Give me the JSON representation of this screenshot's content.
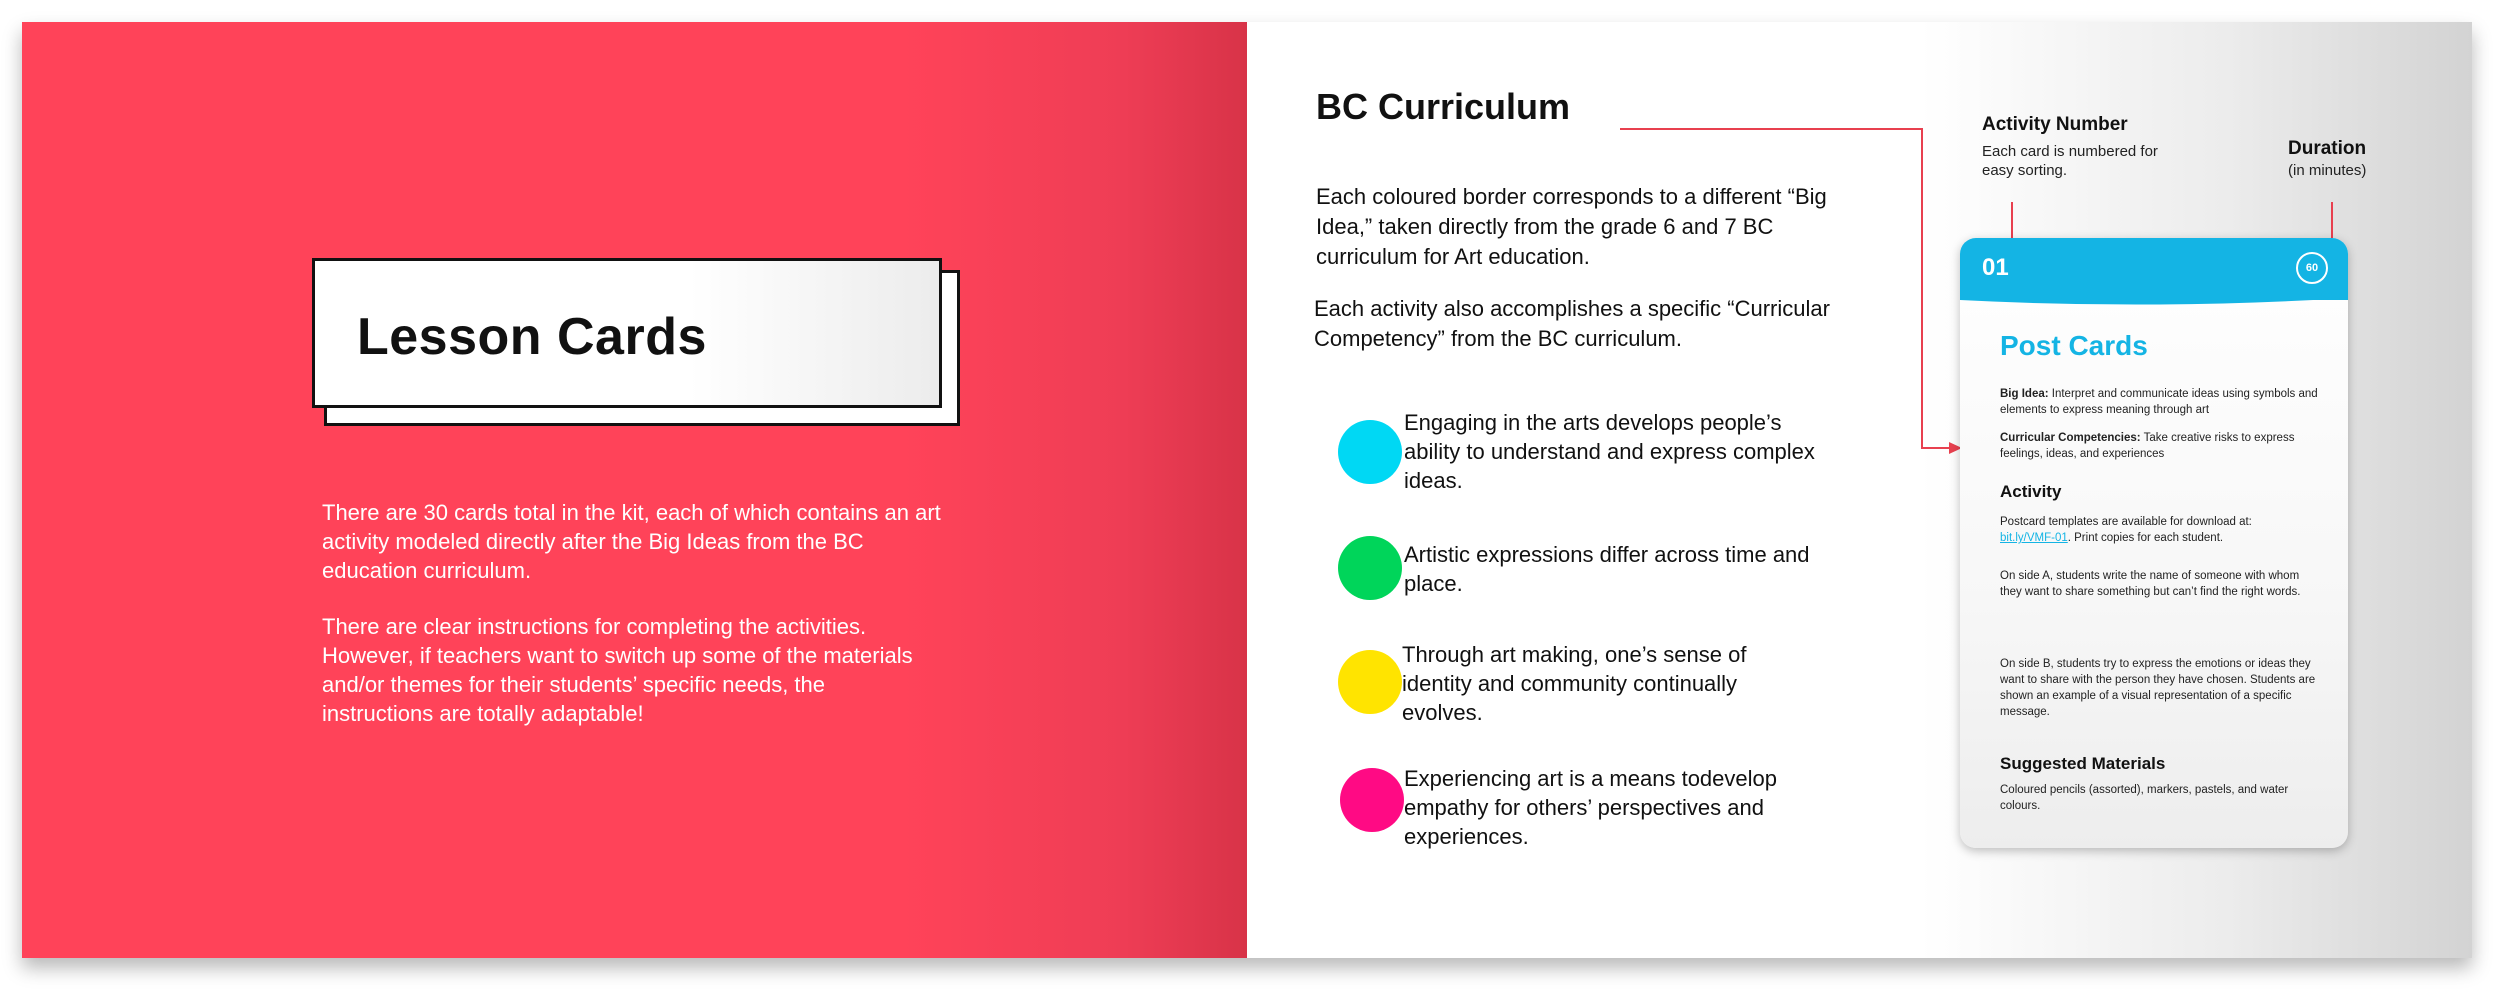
{
  "left_page": {
    "title": "Lesson Cards",
    "paragraphs": [
      "There are 30 cards total in the kit, each of which contains an art activity modeled directly after the Big Ideas from the BC education curriculum.",
      "There are clear instructions for completing the activities. However, if teachers want to switch up some of the materials and/or themes for their students’ specific needs, the instructions are totally adaptable!"
    ]
  },
  "right_page": {
    "title": "BC Curriculum",
    "paragraphs": [
      "Each coloured border corresponds to a different “Big Idea,” taken directly from the grade 6 and 7 BC curriculum for Art education.",
      "Each activity also accomplishes a specific “Curricular Competency” from the  BC curriculum."
    ],
    "big_ideas": [
      {
        "color": "#00d8f4",
        "text": "Engaging in the arts develops people’s ability to understand and express complex ideas."
      },
      {
        "color": "#00d55a",
        "text": "Artistic expressions differ across time and place."
      },
      {
        "color": "#ffe400",
        "text": "Through art making, one’s sense of identity and community continually evolves."
      },
      {
        "color": "#ff0a84",
        "text": "Experiencing art is a means todevelop empathy for others’ perspectives and experiences."
      }
    ],
    "annotations": {
      "activity_number": {
        "title": "Activity Number",
        "desc": "Each card is numbered for easy sorting."
      },
      "duration": {
        "title": "Duration",
        "desc": "(in minutes)"
      }
    },
    "accent_color": "#e8404f"
  },
  "card": {
    "number": "01",
    "duration": "60",
    "header_color": "#14b4e4",
    "title": "Post Cards",
    "big_idea_label": "Big Idea:",
    "big_idea_text": "Interpret and communicate ideas using symbols and elements to express meaning through art",
    "competency_label": "Curricular Competencies:",
    "competency_text": "Take creative risks to express feelings, ideas, and experiences",
    "activity_heading": "Activity",
    "activity_intro": "Postcard templates are available for download at:",
    "activity_link": "bit.ly/VMF-01",
    "activity_intro_end": ". Print copies for each student.",
    "activity_side_a": "On side A, students write the name of someone with whom they want to share something but can’t find the right words.",
    "activity_side_b": "On side B, students try to express the emotions or ideas they want to share with the person they have chosen. Students are shown an example of a visual representation of a specific message.",
    "materials_heading": "Suggested Materials",
    "materials_text": "Coloured pencils (assorted), markers, pastels, and water colours."
  }
}
